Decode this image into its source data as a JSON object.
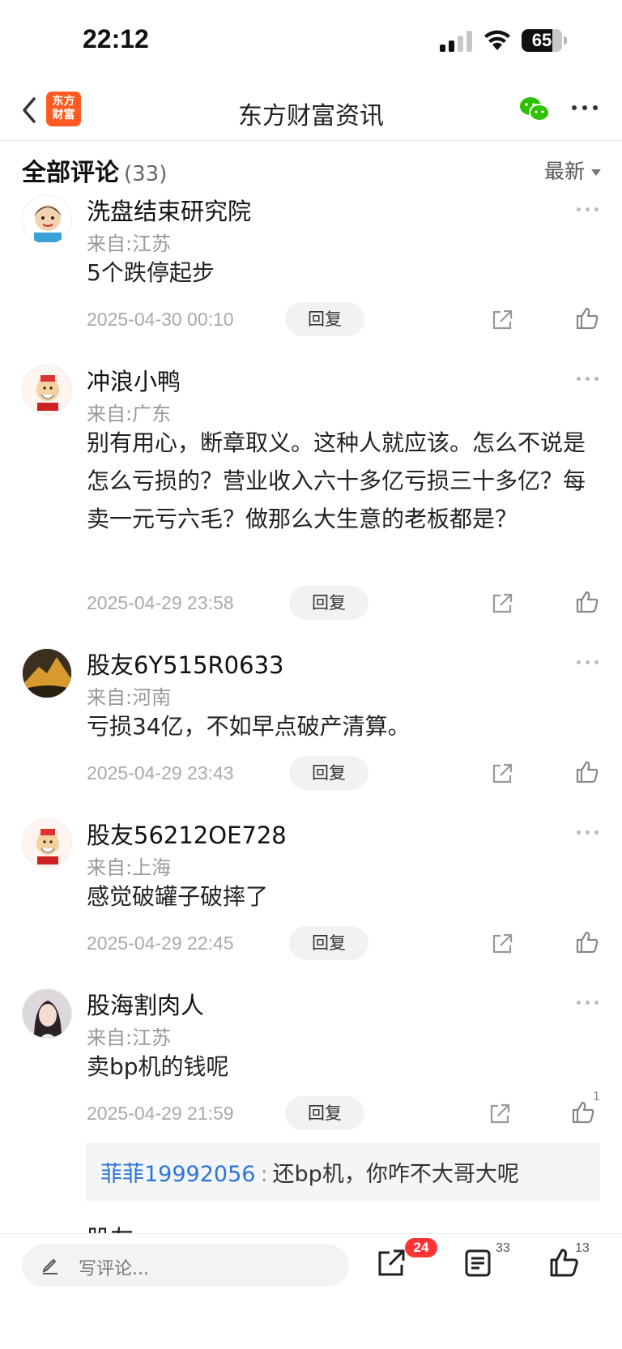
{
  "status_bar": {
    "time": "22:12",
    "battery": "65"
  },
  "nav": {
    "title": "东方财富资讯",
    "logo_line1": "东方",
    "logo_line2": "财富"
  },
  "comments_header": {
    "label": "全部评论",
    "count": "(33)",
    "sort": "最新"
  },
  "comments": [
    {
      "user": "洗盘结束研究院",
      "location": "来自:江苏",
      "text": "5个跌停起步",
      "date": "2025-04-30 00:10",
      "reply": "回复"
    },
    {
      "user": "冲浪小鸭",
      "location": "来自:广东",
      "text": "别有用心，断章取义。这种人就应该。怎么不说是怎么亏损的？营业收入六十多亿亏损三十多亿？每卖一元亏六毛？做那么大生意的老板都是？",
      "date": "2025-04-29 23:58",
      "reply": "回复"
    },
    {
      "user": "股友6Y515R0633",
      "location": "来自:河南",
      "text": "亏损34亿，不如早点破产清算。",
      "date": "2025-04-29 23:43",
      "reply": "回复"
    },
    {
      "user": "股友56212OE728",
      "location": "来自:上海",
      "text": "感觉破罐子破摔了",
      "date": "2025-04-29 22:45",
      "reply": "回复"
    },
    {
      "user": "股海割肉人",
      "location": "来自:江苏",
      "text": "卖bp机的钱呢",
      "date": "2025-04-29 21:59",
      "reply": "回复",
      "like_count": "1",
      "sub_reply": {
        "user": "菲菲19992056",
        "separator": ":",
        "text": "还bp机，你咋不大哥大呢"
      }
    },
    {
      "user": "股友",
      "location": "",
      "text": "",
      "date": "",
      "reply": ""
    }
  ],
  "bottom_bar": {
    "write_placeholder": "写评论...",
    "share_badge": "24",
    "comments_count": "33",
    "likes_count": "13"
  },
  "colors": {
    "accent_orange": "#ff5a1f",
    "link_blue": "#2b74d8",
    "badge_red": "#ff3333",
    "wechat_green": "#2dc100"
  }
}
